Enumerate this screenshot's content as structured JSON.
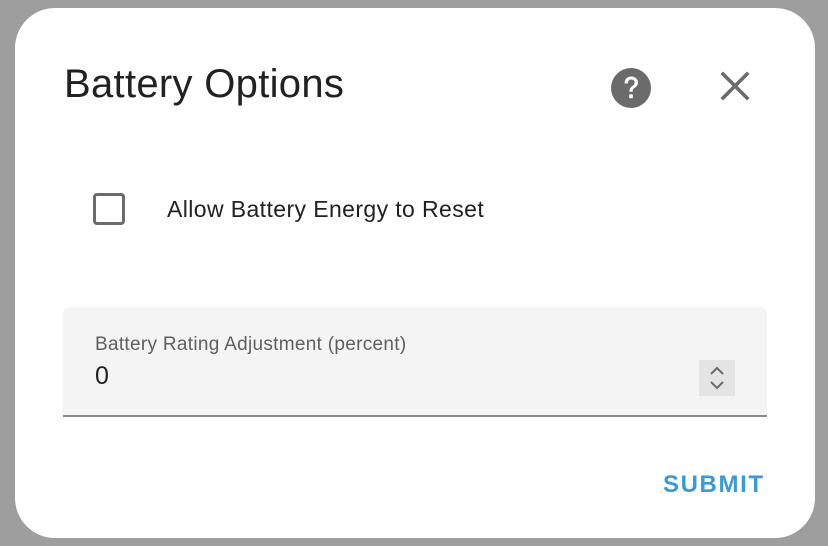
{
  "dialog": {
    "title": "Battery Options",
    "help_icon": "help-circle-icon",
    "close_icon": "close-icon"
  },
  "checkbox": {
    "label": "Allow Battery Energy to Reset",
    "checked": false
  },
  "field": {
    "label": "Battery Rating Adjustment (percent)",
    "value": "0",
    "spinner_icon": "spinner-arrows-icon"
  },
  "actions": {
    "submit_label": "SUBMIT"
  },
  "colors": {
    "backdrop": "#9e9e9e",
    "accent": "#3a9ad9",
    "field_bg": "#f4f4f4",
    "icon": "#6b6b6b"
  }
}
